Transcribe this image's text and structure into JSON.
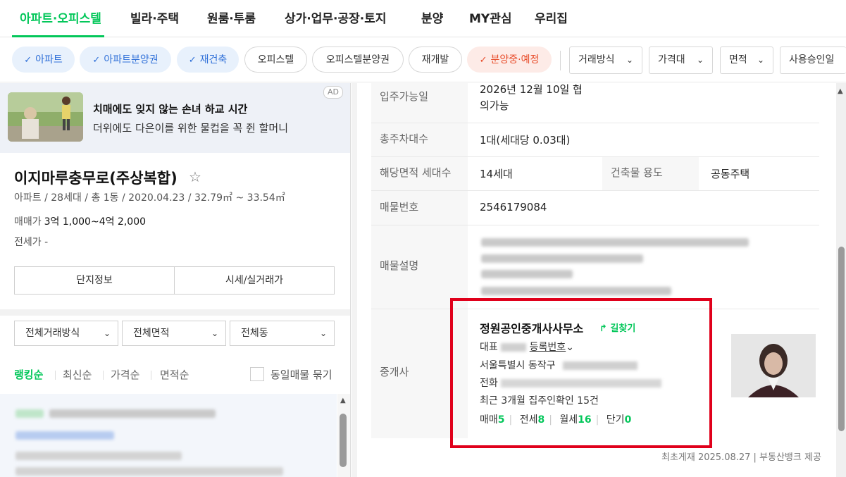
{
  "nav": {
    "tabs": [
      {
        "label": "아파트·오피스텔",
        "active": true
      },
      {
        "label": "빌라·주택"
      },
      {
        "label": "원룸·투룸"
      },
      {
        "label": "상가·업무·공장·토지"
      },
      {
        "label": "분양"
      },
      {
        "label": "MY관심"
      },
      {
        "label": "우리집"
      }
    ]
  },
  "filters": {
    "chips": [
      "아파트",
      "아파트분양권",
      "재건축",
      "오피스텔",
      "오피스텔분양권",
      "재개발",
      "분양중·예정"
    ],
    "dropdowns": [
      "거래방식",
      "가격대",
      "면적",
      "사용승인일"
    ]
  },
  "ad": {
    "title": "치매에도 잊지 않는 손녀 하교 시간",
    "subtitle": "더위에도 다은이를 위한 물컵을 꼭 쥔 할머니",
    "badge": "AD"
  },
  "complex": {
    "name": "이지마루충무로(주상복합)",
    "meta": "아파트 / 28세대 / 총 1동 / 2020.04.23 / 32.79㎡ ~ 33.54㎡",
    "sale_label": "매매가",
    "sale_value": "3억 1,000~4억 2,000",
    "jeonse": "전세가 -",
    "btn_info": "단지정보",
    "btn_price": "시세/실거래가"
  },
  "list_filters": {
    "trade": "전체거래방식",
    "area": "전체면적",
    "dong": "전체동"
  },
  "sort": {
    "options": [
      "랭킹순",
      "최신순",
      "가격순",
      "면적순"
    ],
    "group_label": "동일매물 묶기"
  },
  "detail": {
    "move_in_label": "입주가능일",
    "move_in_value_1": "2026년 12월 10일 협",
    "move_in_value_2": "의가능",
    "parking_label": "총주차대수",
    "parking_value": "1대(세대당 0.03대)",
    "units_label": "해당면적 세대수",
    "units_value": "14세대",
    "use_label": "건축물 용도",
    "use_value": "공동주택",
    "listing_no_label": "매물번호",
    "listing_no_value": "2546179084",
    "desc_label": "매물설명",
    "agent_label": "중개사"
  },
  "agent": {
    "name": "정원공인중개사사무소",
    "route": "길찾기",
    "rep_label": "대표",
    "reg_label": "등록번호",
    "address": "서울특별시 동작구",
    "phone_label": "전화",
    "recent": "최근 3개월 집주인확인 15건",
    "counts": [
      {
        "label": "매매",
        "value": "5"
      },
      {
        "label": "전세",
        "value": "8"
      },
      {
        "label": "월세",
        "value": "16"
      },
      {
        "label": "단기",
        "value": "0"
      }
    ]
  },
  "footer": {
    "note": "최초게재 2025.08.27 | 부동산뱅크 제공"
  },
  "colors": {
    "accent_green": "#03c75a",
    "chip_blue": "#2e6fd8",
    "chip_red": "#e84d2b",
    "highlight_red": "#e0001b"
  }
}
